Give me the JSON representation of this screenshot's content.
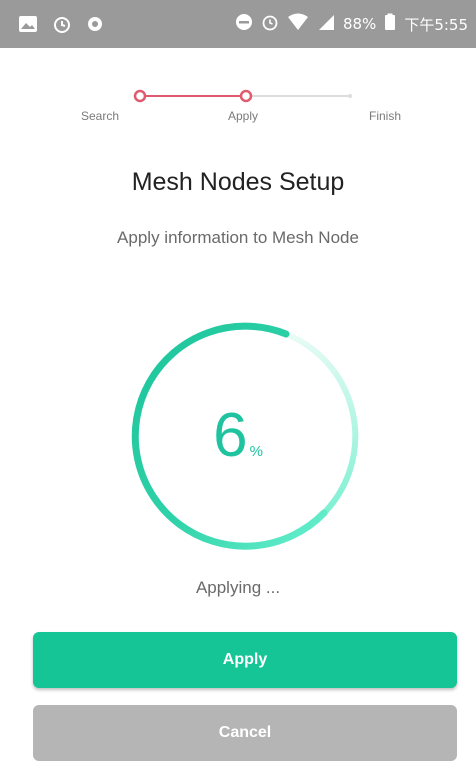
{
  "status_bar": {
    "battery": "88%",
    "time": "下午5:55",
    "icons": [
      "image-icon",
      "alarm-icon",
      "circle-icon",
      "dnd-icon",
      "alarm-icon",
      "wifi-icon",
      "signal-icon",
      "battery-icon"
    ]
  },
  "stepper": {
    "steps": [
      "Search",
      "Apply",
      "Finish"
    ],
    "active_index": 1,
    "active_color": "#e05a6f",
    "inactive_color": "#dddddd"
  },
  "title": "Mesh Nodes Setup",
  "subtitle": "Apply information to Mesh Node",
  "progress": {
    "value": "6",
    "unit": "%",
    "percent": 6,
    "color": "#1fc3a0"
  },
  "status_text": "Applying ...",
  "buttons": {
    "apply": "Apply",
    "cancel": "Cancel"
  }
}
